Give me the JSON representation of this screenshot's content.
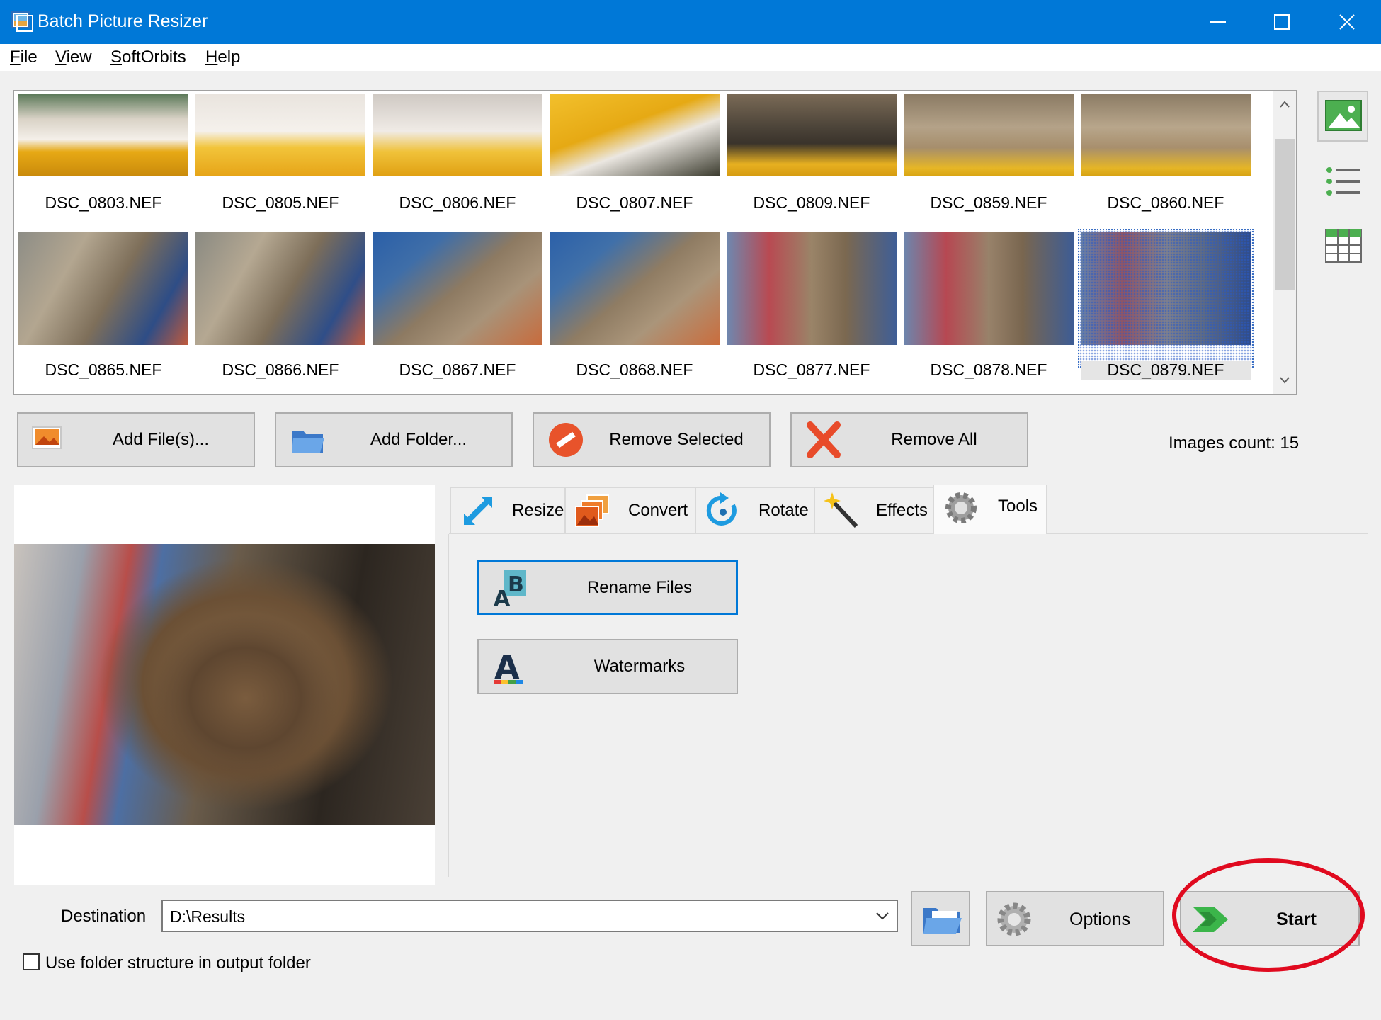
{
  "window": {
    "title": "Batch Picture Resizer"
  },
  "menu": {
    "items": [
      "File",
      "View",
      "SoftOrbits",
      "Help"
    ]
  },
  "thumbnails": [
    {
      "label": "DSC_0803.NEF",
      "selected": false
    },
    {
      "label": "DSC_0805.NEF",
      "selected": false
    },
    {
      "label": "DSC_0806.NEF",
      "selected": false
    },
    {
      "label": "DSC_0807.NEF",
      "selected": false
    },
    {
      "label": "DSC_0809.NEF",
      "selected": false
    },
    {
      "label": "DSC_0859.NEF",
      "selected": false
    },
    {
      "label": "DSC_0860.NEF",
      "selected": false
    },
    {
      "label": "DSC_0865.NEF",
      "selected": false
    },
    {
      "label": "DSC_0866.NEF",
      "selected": false
    },
    {
      "label": "DSC_0867.NEF",
      "selected": false
    },
    {
      "label": "DSC_0868.NEF",
      "selected": false
    },
    {
      "label": "DSC_0877.NEF",
      "selected": false
    },
    {
      "label": "DSC_0878.NEF",
      "selected": false
    },
    {
      "label": "DSC_0879.NEF",
      "selected": true
    }
  ],
  "actions": {
    "add_files": "Add File(s)...",
    "add_folder": "Add Folder...",
    "remove_selected": "Remove Selected",
    "remove_all": "Remove All"
  },
  "images_count": "Images count: 15",
  "tabs": [
    {
      "label": "Resize",
      "icon": "resize-icon"
    },
    {
      "label": "Convert",
      "icon": "convert-icon"
    },
    {
      "label": "Rotate",
      "icon": "rotate-icon"
    },
    {
      "label": "Effects",
      "icon": "effects-icon"
    },
    {
      "label": "Tools",
      "icon": "gear-icon",
      "active": true
    }
  ],
  "tools": {
    "rename_files": "Rename Files",
    "watermarks": "Watermarks"
  },
  "destination": {
    "label": "Destination",
    "value": "D:\\Results"
  },
  "buttons": {
    "options": "Options",
    "start": "Start"
  },
  "checkbox": {
    "label": "Use folder structure in output folder",
    "checked": false
  },
  "colors": {
    "titlebar": "#0078d7",
    "highlight": "#e00a1f",
    "focus": "#0078d7"
  }
}
